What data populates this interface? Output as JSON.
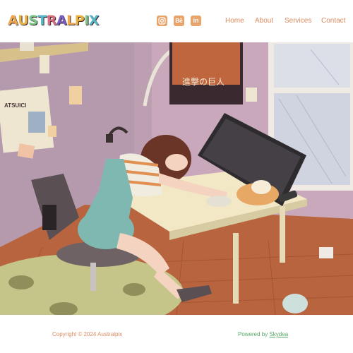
{
  "brand": {
    "logo_text": "AUSTRALPIX",
    "logo_letter_colors": [
      "#f0a84a",
      "#e8b23e",
      "#7cc88a",
      "#58b6c6",
      "#d56c7c",
      "#7c5ec0",
      "#f0a84a",
      "#e8b23e",
      "#7cc88a",
      "#58b6c6"
    ]
  },
  "social": [
    {
      "name": "instagram-icon",
      "glyph": "instagram"
    },
    {
      "name": "behance-icon",
      "glyph": "Bē"
    },
    {
      "name": "linkedin-icon",
      "glyph": "in"
    }
  ],
  "nav": {
    "items": [
      "Home",
      "About",
      "Services",
      "Contact"
    ]
  },
  "hero": {
    "poster_text": "進撃の巨人",
    "note_text": "ATSUICI"
  },
  "footer": {
    "copyright": "Copyright © 2024 Australpix",
    "powered_prefix": "Powered by ",
    "powered_link": "Skydea"
  },
  "colors": {
    "accent": "#e9a46c",
    "nav_text": "#d98a5f",
    "powered_green": "#57a86a"
  }
}
